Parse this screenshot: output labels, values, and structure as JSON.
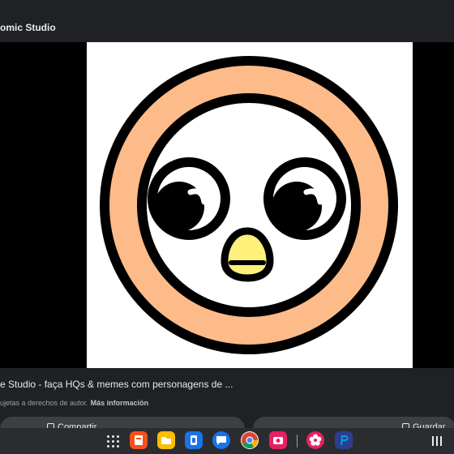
{
  "window": {
    "title": "omic Studio"
  },
  "viewer": {
    "caption": "e Studio - faça HQs & memes com personagens de ...",
    "notice": "ujetas a derechos de autor.",
    "more_link": "Más información"
  },
  "actions": {
    "share_label": "Compartir",
    "save_label": "Guardar"
  },
  "shelf": {
    "apps": [
      {
        "icon": "launcher-icon"
      },
      {
        "icon": "keep-icon",
        "color": "#f4511e"
      },
      {
        "icon": "files-icon",
        "color": "#fbbc04"
      },
      {
        "icon": "bank-icon",
        "color": "#1a73e8"
      },
      {
        "icon": "messages-icon",
        "color": "#1a73e8"
      },
      {
        "icon": "chrome-icon"
      },
      {
        "icon": "camera-icon",
        "color": "#e91e63"
      },
      {
        "icon": "flower-icon",
        "color": "#e91e63"
      },
      {
        "icon": "paypal-icon",
        "color": "#2d3e8c"
      },
      {
        "icon": "overview-icon"
      }
    ]
  },
  "colors": {
    "background": "#202124",
    "owl_ring": "#fcbb88",
    "owl_beak": "#fef07a",
    "outline": "#000000"
  }
}
